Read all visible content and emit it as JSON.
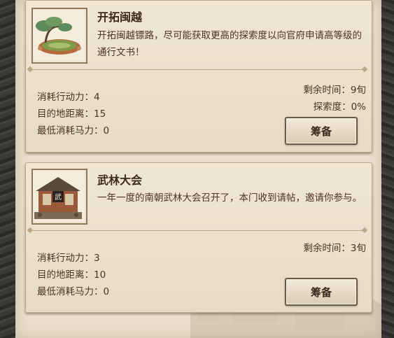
{
  "quests": [
    {
      "title": "开拓闽越",
      "description": "开拓闽越镖路，尽可能获取更高的探索度以向官府申请高等级的通行文书！",
      "stats": [
        "消耗行动力：4",
        "目的地距离：15",
        "最低消耗马力：0"
      ],
      "remaining_time": "剩余时间：9旬",
      "exploration": "探索度：0%",
      "button_label": "筹备",
      "thumb_icon": "bonsai-courtyard-icon"
    },
    {
      "title": "武林大会",
      "description": "一年一度的南朝武林大会召开了，本门收到请帖，邀请你参与。",
      "stats": [
        "消耗行动力：3",
        "目的地距离：10",
        "最低消耗马力：0"
      ],
      "remaining_time": "剩余时间：3旬",
      "button_label": "筹备",
      "thumb_icon": "pavilion-banner-icon"
    }
  ],
  "colors": {
    "panel_bg": "#e8decb",
    "card_bg": "#efe6d4",
    "text": "#4a3424",
    "frame": "#2a2a28"
  }
}
